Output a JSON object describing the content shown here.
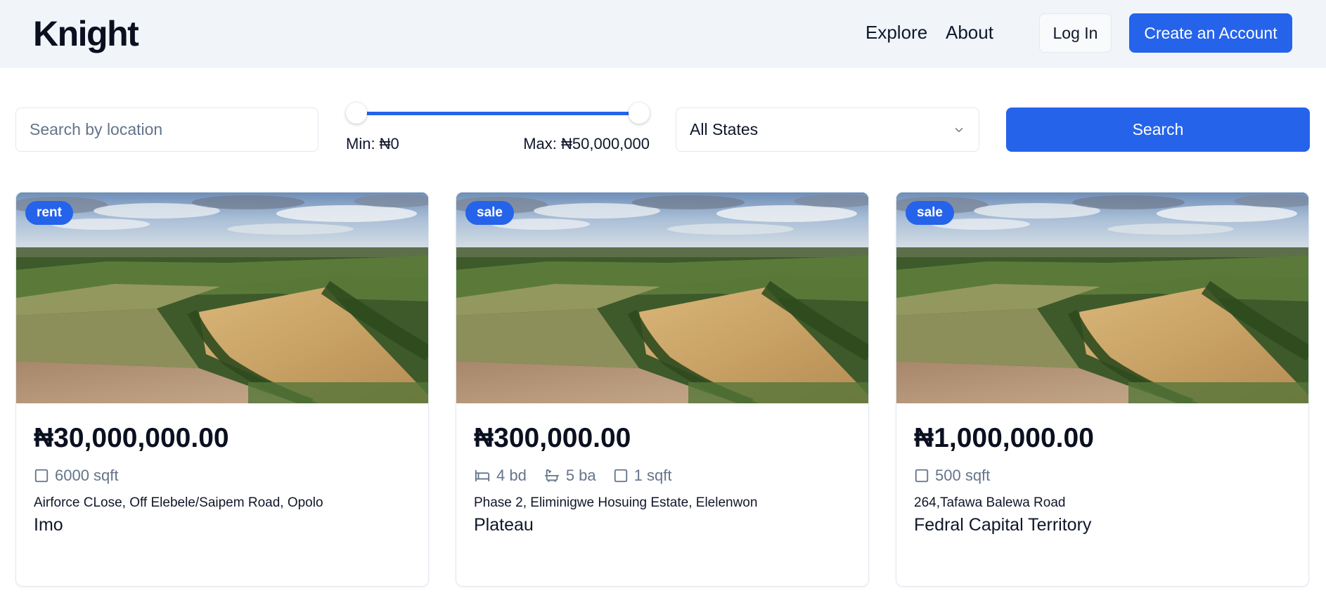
{
  "header": {
    "logo": "Knight",
    "nav": {
      "explore": "Explore",
      "about": "About"
    },
    "login_label": "Log In",
    "create_account_label": "Create an Account"
  },
  "filters": {
    "search_placeholder": "Search by location",
    "price_min_label": "Min: ₦0",
    "price_max_label": "Max: ₦50,000,000",
    "price_range_fraction": {
      "min": 0,
      "max": 1
    },
    "state_selected": "All States",
    "search_label": "Search"
  },
  "listings": [
    {
      "badge": "rent",
      "price": "₦30,000,000.00",
      "features": {
        "sqft": "6000 sqft"
      },
      "address": "Airforce CLose, Off Elebele/Saipem Road, Opolo",
      "state": "Imo"
    },
    {
      "badge": "sale",
      "price": "₦300,000.00",
      "features": {
        "beds": "4 bd",
        "baths": "5 ba",
        "sqft": "1 sqft"
      },
      "address": "Phase 2, Eliminigwe Hosuing Estate, Elelenwon",
      "state": "Plateau"
    },
    {
      "badge": "sale",
      "price": "₦1,000,000.00",
      "features": {
        "sqft": "500 sqft"
      },
      "address": "264,Tafawa Balewa Road",
      "state": "Fedral Capital Territory"
    }
  ],
  "colors": {
    "accent": "#2563eb",
    "header_bg": "#f1f5f9",
    "muted_text": "#64748b",
    "border": "#e2e8f0"
  },
  "icons": {
    "sqft": "square-icon",
    "beds": "bed-icon",
    "baths": "bathtub-icon",
    "select": "chevron-down-icon"
  }
}
